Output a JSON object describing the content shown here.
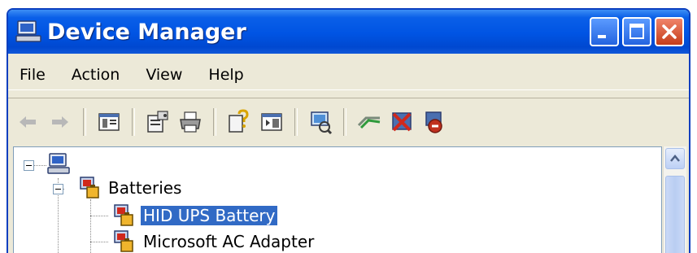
{
  "window": {
    "title": "Device Manager",
    "buttons": [
      "minimize",
      "maximize",
      "close"
    ]
  },
  "menu": [
    "File",
    "Action",
    "View",
    "Help"
  ],
  "toolbar": {
    "icons": [
      "back-arrow-icon",
      "forward-arrow-icon",
      "show-hide-tree-icon",
      "properties-icon",
      "print-icon",
      "help-icon",
      "show-hide-action-pane-icon",
      "scan-hardware-icon",
      "update-driver-icon",
      "disable-device-icon",
      "uninstall-device-icon"
    ]
  },
  "tree": {
    "root_label": "",
    "category": "Batteries",
    "items": [
      {
        "label": "HID UPS Battery",
        "selected": true
      },
      {
        "label": "Microsoft AC Adapter",
        "selected": false
      }
    ]
  },
  "colors": {
    "titlebar": "#0054e3",
    "selection": "#316ac5",
    "window_bg": "#ece9d8",
    "close_button": "#c53d1a"
  }
}
